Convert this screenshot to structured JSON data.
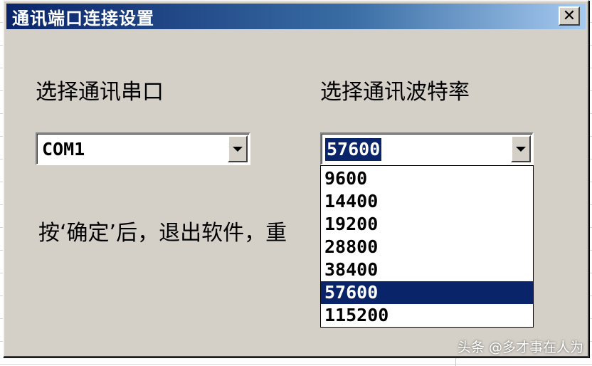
{
  "window": {
    "title": "通讯端口连接设置",
    "close_label": "✕"
  },
  "port": {
    "label": "选择通讯串口",
    "value": "COM1"
  },
  "baud": {
    "label": "选择通讯波特率",
    "value": "57600",
    "options": [
      "9600",
      "14400",
      "19200",
      "28800",
      "38400",
      "57600",
      "115200"
    ],
    "selected_index": 5
  },
  "note_text": "按‘确定’后，退出软件，重",
  "watermark": "头条 @多才事在人为",
  "colors": {
    "dialog_bg": "#d4d0c8",
    "title_start": "#0a246a",
    "selection": "#0a246a"
  }
}
